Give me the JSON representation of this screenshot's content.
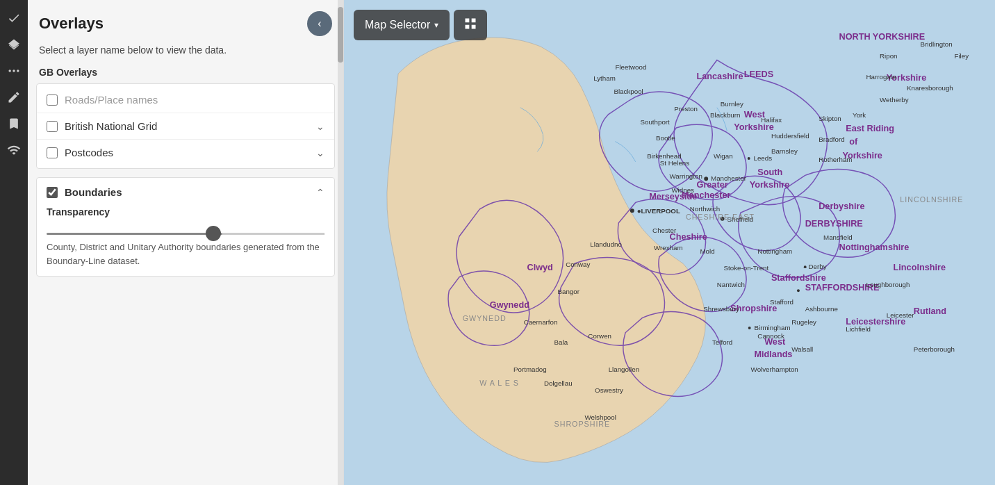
{
  "iconBar": {
    "items": [
      {
        "name": "check-icon",
        "symbol": "✓"
      },
      {
        "name": "layers-icon",
        "symbol": "⊞"
      },
      {
        "name": "dots-icon",
        "symbol": "⠿"
      },
      {
        "name": "edit-icon",
        "symbol": "✎"
      },
      {
        "name": "bookmark-icon",
        "symbol": "⚑"
      },
      {
        "name": "signal-icon",
        "symbol": "▲"
      }
    ]
  },
  "sidebar": {
    "title": "Overlays",
    "subtitle": "Select a layer name below to view the data.",
    "gbOverlaysLabel": "GB Overlays",
    "collapseButton": "‹",
    "overlayItems": [
      {
        "id": "roads",
        "label": "Roads/Place names",
        "checked": false,
        "hasChevron": false,
        "disabled": true
      },
      {
        "id": "bng",
        "label": "British National Grid",
        "checked": false,
        "hasChevron": true
      },
      {
        "id": "postcodes",
        "label": "Postcodes",
        "checked": false,
        "hasChevron": true
      }
    ],
    "boundariesSection": {
      "label": "Boundaries",
      "checked": true,
      "transparencyLabel": "Transparency",
      "sliderValue": 60,
      "description": "County, District and Unitary Authority boundaries generated from the Boundary-Line dataset."
    }
  },
  "mapToolbar": {
    "selectorLabel": "Map Selector",
    "selectorChevron": "▾",
    "gridIcon": "⊞"
  }
}
